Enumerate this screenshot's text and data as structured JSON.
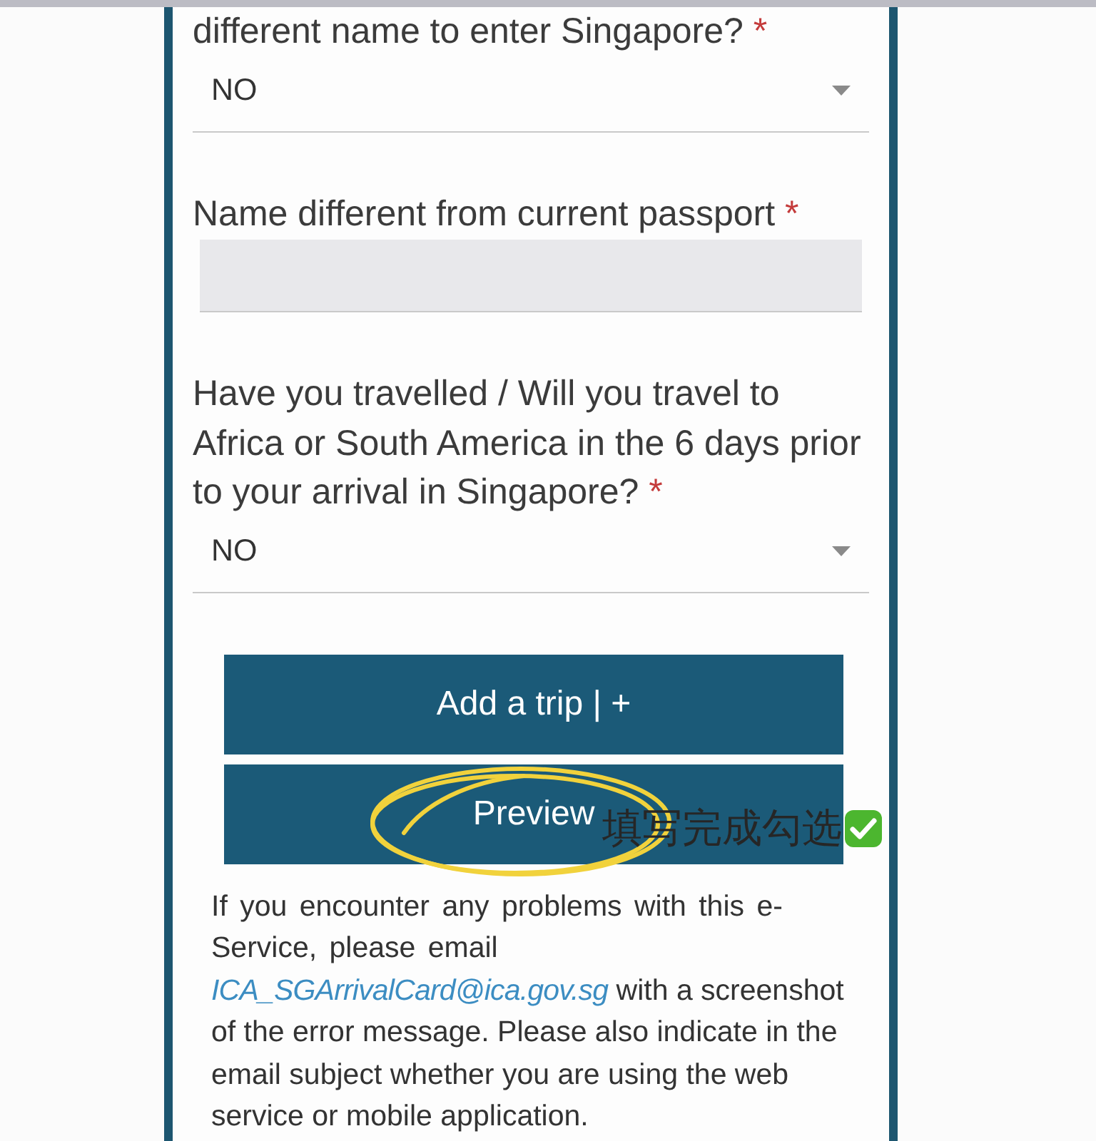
{
  "form": {
    "fields": [
      {
        "kind": "select",
        "label": "different name to enter Singapore?",
        "required_mark": "*",
        "value": "NO"
      },
      {
        "kind": "text",
        "label": "Name different from current passport",
        "required_mark": "*",
        "disabled": true
      },
      {
        "kind": "select",
        "label": "Have you travelled / Will you travel to Africa or South America in the 6 days prior to your arrival in Singapore?",
        "required_mark": "*",
        "value": "NO"
      }
    ],
    "buttons": [
      {
        "label": "Add a trip | +",
        "highlighted": false
      },
      {
        "label": "Preview",
        "highlighted": true
      }
    ],
    "help_text": {
      "before": "If you encounter any problems with this e-Service, please email ",
      "link": "ICA_SGArrivalCard@ica.gov.sg",
      "after": " with a screenshot of the error message. Please also indicate in the email subject whether you are using the web service or mobile application."
    }
  },
  "annotation": {
    "text": "填写完成勾选"
  }
}
